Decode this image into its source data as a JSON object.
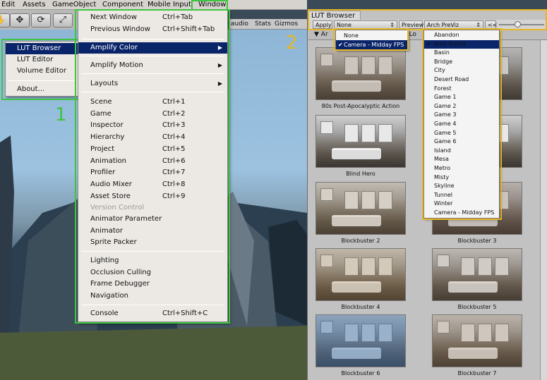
{
  "menubar": [
    "Edit",
    "Assets",
    "GameObject",
    "Component",
    "Mobile Input",
    "Window"
  ],
  "game_tabs": [
    "te audio",
    "Stats",
    "Gizmos"
  ],
  "toolbar_icons": [
    "hand-icon",
    "move-icon",
    "rotate-icon",
    "scale-icon"
  ],
  "left_menu": {
    "items": [
      "LUT Browser",
      "LUT Editor",
      "Volume Editor"
    ],
    "about": "About..."
  },
  "window_menu": {
    "next_window": {
      "label": "Next Window",
      "shortcut": "Ctrl+Tab"
    },
    "previous_window": {
      "label": "Previous Window",
      "shortcut": "Ctrl+Shift+Tab"
    },
    "amplify_color": "Amplify Color",
    "amplify_motion": "Amplify Motion",
    "layouts": "Layouts",
    "views": [
      {
        "label": "Scene",
        "shortcut": "Ctrl+1"
      },
      {
        "label": "Game",
        "shortcut": "Ctrl+2"
      },
      {
        "label": "Inspector",
        "shortcut": "Ctrl+3"
      },
      {
        "label": "Hierarchy",
        "shortcut": "Ctrl+4"
      },
      {
        "label": "Project",
        "shortcut": "Ctrl+5"
      },
      {
        "label": "Animation",
        "shortcut": "Ctrl+6"
      },
      {
        "label": "Profiler",
        "shortcut": "Ctrl+7"
      },
      {
        "label": "Audio Mixer",
        "shortcut": "Ctrl+8"
      },
      {
        "label": "Asset Store",
        "shortcut": "Ctrl+9"
      }
    ],
    "version_control": "Version Control",
    "tools": [
      "Animator Parameter",
      "Animator",
      "Sprite Packer"
    ],
    "lighting": [
      "Lighting",
      "Occlusion Culling",
      "Frame Debugger",
      "Navigation"
    ],
    "console": {
      "label": "Console",
      "shortcut": "Ctrl+Shift+C"
    }
  },
  "labels": {
    "one": "1",
    "two": "2"
  },
  "lut_browser": {
    "tab": "LUT Browser",
    "apply": "Apply",
    "apply_value": "None",
    "preview": "Preview",
    "preview_value": "Arch PreViz",
    "collapse": "<<",
    "section": "Ar",
    "section_right": "r Lo",
    "thumbnails": [
      "80s Post-Apocalyptic Action",
      "ptic Drama",
      "Blind Hero",
      "r 1",
      "Blockbuster 2",
      "Blockbuster 3",
      "Blockbuster 4",
      "Blockbuster 5",
      "Blockbuster 6",
      "Blockbuster 7"
    ],
    "apply_options": [
      "None",
      "Camera - Midday FPS"
    ],
    "apply_selected": 1,
    "preview_options": [
      "Abandon",
      "Arch PreViz",
      "Basin",
      "Bridge",
      "City",
      "Desert Road",
      "Forest",
      "Game 1",
      "Game 2",
      "Game 3",
      "Game 4",
      "Game 5",
      "Game 6",
      "Island",
      "Mesa",
      "Metro",
      "Misty",
      "Skyline",
      "Tunnel",
      "Winter",
      "Camera - Midday FPS"
    ],
    "preview_selected": 1
  },
  "colors": {
    "highlight_green": "#3ec43e",
    "highlight_yellow": "#e6b625",
    "menu_selection": "#0a246a"
  }
}
